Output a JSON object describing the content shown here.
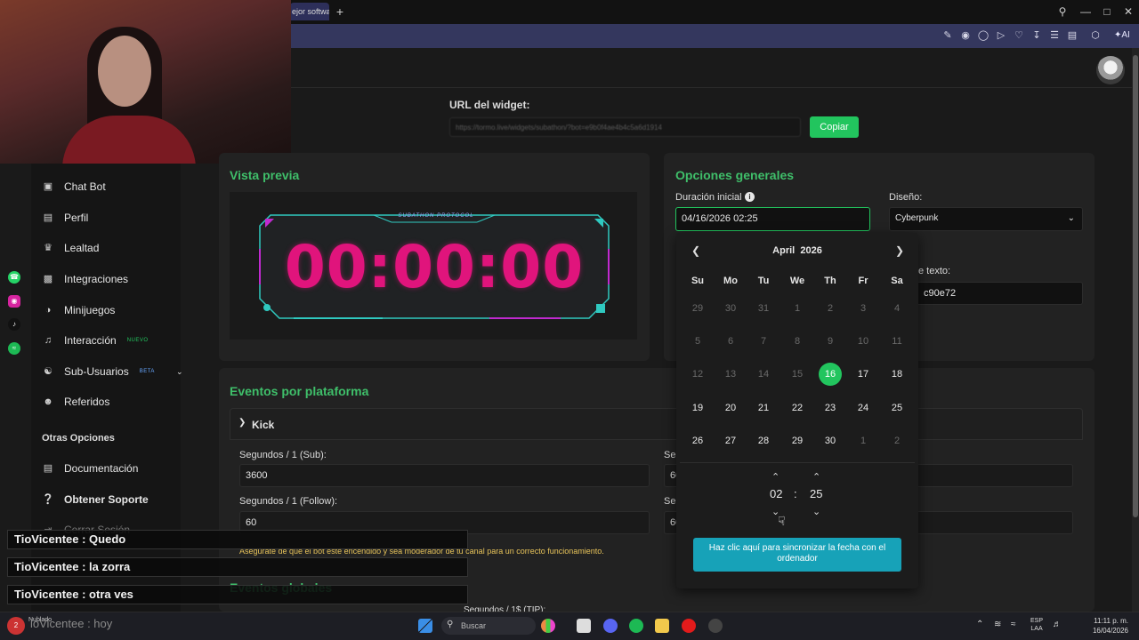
{
  "browser": {
    "tab_title": "ejor softwa",
    "new_tab": "+",
    "ai_label": "AI"
  },
  "sidebar": {
    "items": [
      {
        "label": "Chat Bot",
        "icon": "robot-icon"
      },
      {
        "label": "Perfil",
        "icon": "id-card-icon"
      },
      {
        "label": "Lealtad",
        "icon": "crown-icon"
      },
      {
        "label": "Integraciones",
        "icon": "plug-icon"
      },
      {
        "label": "Minijuegos",
        "icon": "gamepad-icon"
      },
      {
        "label": "Interacción",
        "icon": "music-icon",
        "badge": "NUEVO"
      },
      {
        "label": "Sub-Usuarios",
        "icon": "users-icon",
        "badge": "BETA"
      },
      {
        "label": "Referidos",
        "icon": "user-group-icon"
      }
    ],
    "section_title": "Otras Opciones",
    "other_items": [
      {
        "label": "Documentación",
        "icon": "document-icon"
      },
      {
        "label": "Obtener Soporte",
        "icon": "help-icon"
      },
      {
        "label": "Cerrar Sesión",
        "icon": "logout-icon"
      }
    ]
  },
  "widget": {
    "url_label": "URL del widget:",
    "url_value": "https://tormo.live/widgets/subathon/?bot=e9b0f4ae4b4c5a6d1914",
    "copy_label": "Copiar"
  },
  "preview": {
    "title": "Vista previa",
    "header": "SUBATHON PROTOCOL",
    "timer": "00:00:00"
  },
  "options": {
    "title": "Opciones generales",
    "duration_label": "Duración inicial",
    "duration_value": "04/16/2026 02:25",
    "design_label": "Diseño:",
    "design_value": "Cyberpunk",
    "text_color_label": "e texto:",
    "text_color_value": "c90e72"
  },
  "datepicker": {
    "month": "April",
    "year": "2026",
    "weekdays": [
      "Su",
      "Mo",
      "Tu",
      "We",
      "Th",
      "Fr",
      "Sa"
    ],
    "weeks": [
      [
        "29",
        "30",
        "31",
        "1",
        "2",
        "3",
        "4"
      ],
      [
        "5",
        "6",
        "7",
        "8",
        "9",
        "10",
        "11"
      ],
      [
        "12",
        "13",
        "14",
        "15",
        "16",
        "17",
        "18"
      ],
      [
        "19",
        "20",
        "21",
        "22",
        "23",
        "24",
        "25"
      ],
      [
        "26",
        "27",
        "28",
        "29",
        "30",
        "1",
        "2"
      ]
    ],
    "selected": "16",
    "hour": "02",
    "minute": "25",
    "sync_label": "Haz clic aquí para sincronizar la fecha con el ordenador"
  },
  "events": {
    "title": "Eventos por plataforma",
    "platform": "Kick",
    "sub_label": "Segundos / 1 (Sub):",
    "sub_value": "3600",
    "follow_label": "Segundos / 1 (Follow):",
    "follow_value": "60",
    "right_label_1": "Seg",
    "right_value_1": "60",
    "right_label_2": "Seg",
    "right_value_2": "60",
    "warning": "Asegúrate de que el bot esté encendido y sea moderador de tu canal para un correcto funcionamiento.",
    "global_title": "Eventos globales",
    "tip_label": "Segundos / 1$ (TIP):"
  },
  "chat": [
    "TioVicentee : Quedo",
    "TioVicentee : la zorra",
    "TioVicentee : otra ves",
    "ioVicentee : hoy"
  ],
  "taskbar": {
    "search_placeholder": "Buscar",
    "weather": "Nublado",
    "lang_line1": "ESP",
    "lang_line2": "LAA",
    "time": "11:11 p. m.",
    "date": "16/04/2026"
  }
}
